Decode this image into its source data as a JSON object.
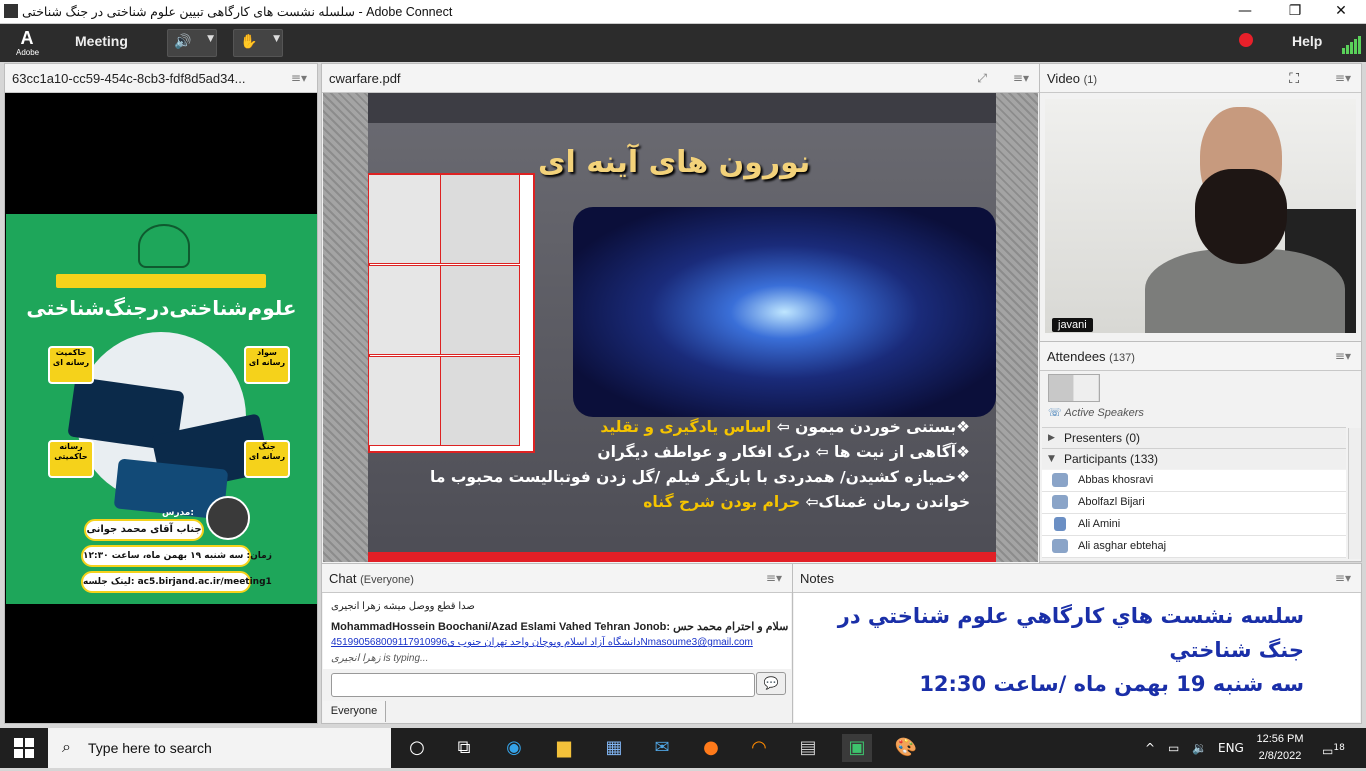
{
  "window": {
    "title": "سلسله نشست های کارگاهی تبیین علوم شناختی در جنگ شناختی - Adobe Connect",
    "controls": {
      "minimize": "—",
      "maximize": "❐",
      "close": "✕"
    }
  },
  "topbar": {
    "logo_letter": "A",
    "logo_text": "Adobe",
    "menu_meeting": "Meeting",
    "help": "Help",
    "speaker_icon": "speaker-icon",
    "hand_icon": "raise-hand-icon",
    "record_color": "#e8202a"
  },
  "left_pod": {
    "title": "63cc1a10-cc59-454c-8cb3-fdf8d5ad34...",
    "poster": {
      "title": "علوم‌شناختی‌درجنگ‌شناختی",
      "badges": [
        "حاکمیت رسانه ای",
        "سواد رسانه ای",
        "رسانه حاکمیتی",
        "جنگ رسانه ای"
      ],
      "instructor_label": "مدرس:",
      "instructor": "جناب آقای محمد جوانی",
      "time": "زمان: سه شنبه ۱۹ بهمن ماه، ساعت ۱۲:۳۰",
      "link": "لینک جلسه: ac5.birjand.ac.ir/meeting1"
    }
  },
  "pdf_pod": {
    "title": "cwarfare.pdf",
    "slide": {
      "heading": "نورون های آینه ای",
      "bullets": [
        {
          "pre": "❖بستنی خوردن میمون ⇦ ",
          "hl": "اساس یادگیری و تقلید",
          "post": ""
        },
        {
          "pre": "❖آگاهی از نیت ها ⇦ درک افکار و عواطف دیگران",
          "hl": "",
          "post": ""
        },
        {
          "pre": "❖خمیازه کشیدن/ همدردی با بازیگر فیلم /گل زدن فوتبالیست محبوب ما",
          "hl": "",
          "post": ""
        },
        {
          "pre": "خواندن رمان غمناک⇦ ",
          "hl": "حرام بودن شرح گناه",
          "post": ""
        }
      ]
    }
  },
  "video_pod": {
    "title": "Video",
    "count": "(1)",
    "name_tag": "javani"
  },
  "attendees_pod": {
    "title": "Attendees",
    "count": "(137)",
    "active_speakers": "Active Speakers",
    "presenters": "Presenters (0)",
    "participants": "Participants (133)",
    "people": [
      "Abbas khosravi",
      "Abolfazl Bijari",
      "Ali Amini",
      "Ali asghar ebtehaj"
    ]
  },
  "chat_pod": {
    "title": "Chat",
    "scope": "(Everyone)",
    "messages": [
      "صدا قطع ووصل میشه زهرا انجیری",
      "MohammadHossein Boochani/Azad Eslami Vahed Tehran Jonob: سلام و احترام محمد حس",
      "4519905680دانشگاه آزاد اسلام ویوچان واحد تهران جنوب ی09117910996Nmasoume3@gmail.com",
      "زهرا انجیری is typing..."
    ],
    "input_placeholder": "",
    "tab": "Everyone"
  },
  "notes_pod": {
    "title": "Notes",
    "lines": [
      "سلسه نشست هاي كارگاهي علوم شناختي در جنگ شناختي",
      "سه شنبه 19 بهمن ماه /ساعت 12:30"
    ]
  },
  "taskbar": {
    "search_placeholder": "Type here to search",
    "language": "ENG",
    "time": "12:56 PM",
    "date": "2/8/2022",
    "notifications": "18"
  }
}
